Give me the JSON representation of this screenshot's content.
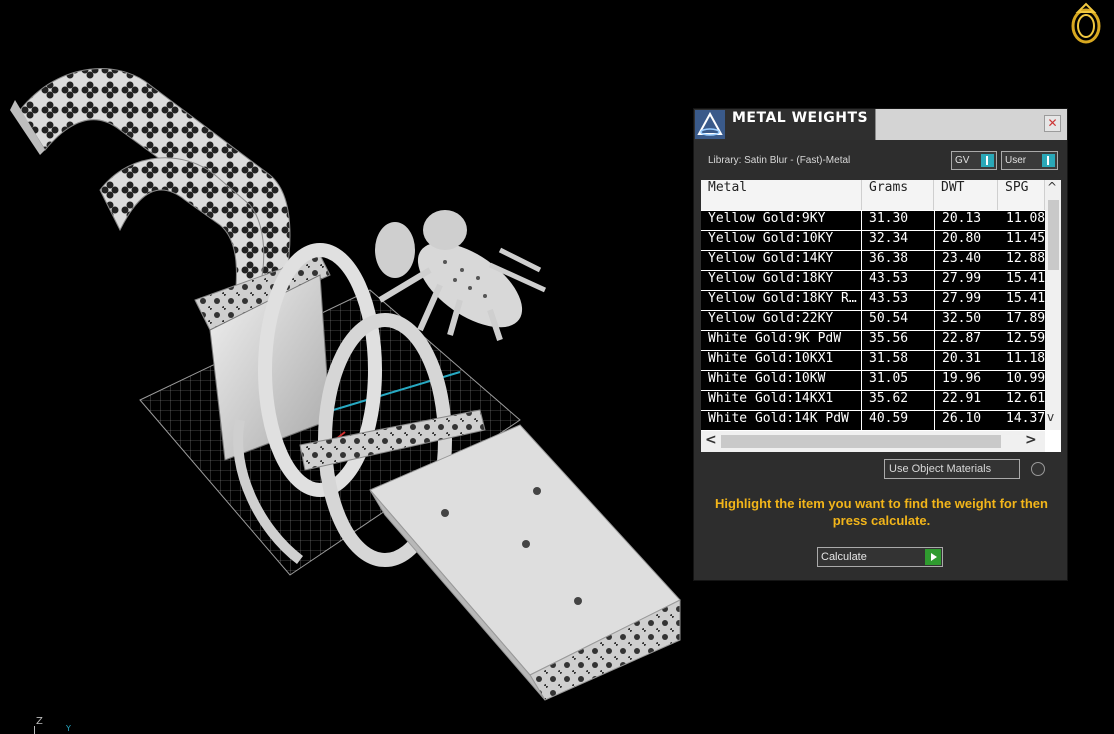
{
  "panel": {
    "title": "METAL WEIGHTS",
    "close_glyph": "✕",
    "library_label": "Library: Satin Blur - (Fast)-Metal",
    "toggle_gv": "GV",
    "toggle_user": "User",
    "columns": [
      "Metal",
      "Grams",
      "DWT",
      "SPG"
    ],
    "rows": [
      [
        "Yellow Gold:9KY",
        "31.30",
        "20.13",
        "11.08"
      ],
      [
        "Yellow Gold:10KY",
        "32.34",
        "20.80",
        "11.45"
      ],
      [
        "Yellow Gold:14KY",
        "36.38",
        "23.40",
        "12.88"
      ],
      [
        "Yellow Gold:18KY",
        "43.53",
        "27.99",
        "15.41"
      ],
      [
        "Yellow Gold:18KY R…",
        "43.53",
        "27.99",
        "15.41"
      ],
      [
        "Yellow Gold:22KY",
        "50.54",
        "32.50",
        "17.89"
      ],
      [
        "White Gold:9K PdW",
        "35.56",
        "22.87",
        "12.59"
      ],
      [
        "White Gold:10KX1",
        "31.58",
        "20.31",
        "11.18"
      ],
      [
        "White Gold:10KW",
        "31.05",
        "19.96",
        "10.99"
      ],
      [
        "White Gold:14KX1",
        "35.62",
        "22.91",
        "12.61"
      ],
      [
        "White Gold:14K PdW",
        "40.59",
        "26.10",
        "14.37"
      ]
    ],
    "scroll_up": "^",
    "scroll_down": "v",
    "scroll_left": "<",
    "scroll_right": ">",
    "use_object_materials": "Use Object Materials",
    "hint": "Highlight the item you want to find the weight for then press calculate.",
    "calculate_label": "Calculate"
  },
  "axis": {
    "z": "Z",
    "y": "Y"
  },
  "colors": {
    "hint": "#f2b51a",
    "toggle_knob": "#2aa8b8",
    "calc_play": "#2f9b2f",
    "grid": "#8a8a8a",
    "axis_cyan": "#27a9c2"
  },
  "icons": [
    "ring-icon",
    "metal-weights-logo-icon",
    "close-icon",
    "play-icon"
  ]
}
